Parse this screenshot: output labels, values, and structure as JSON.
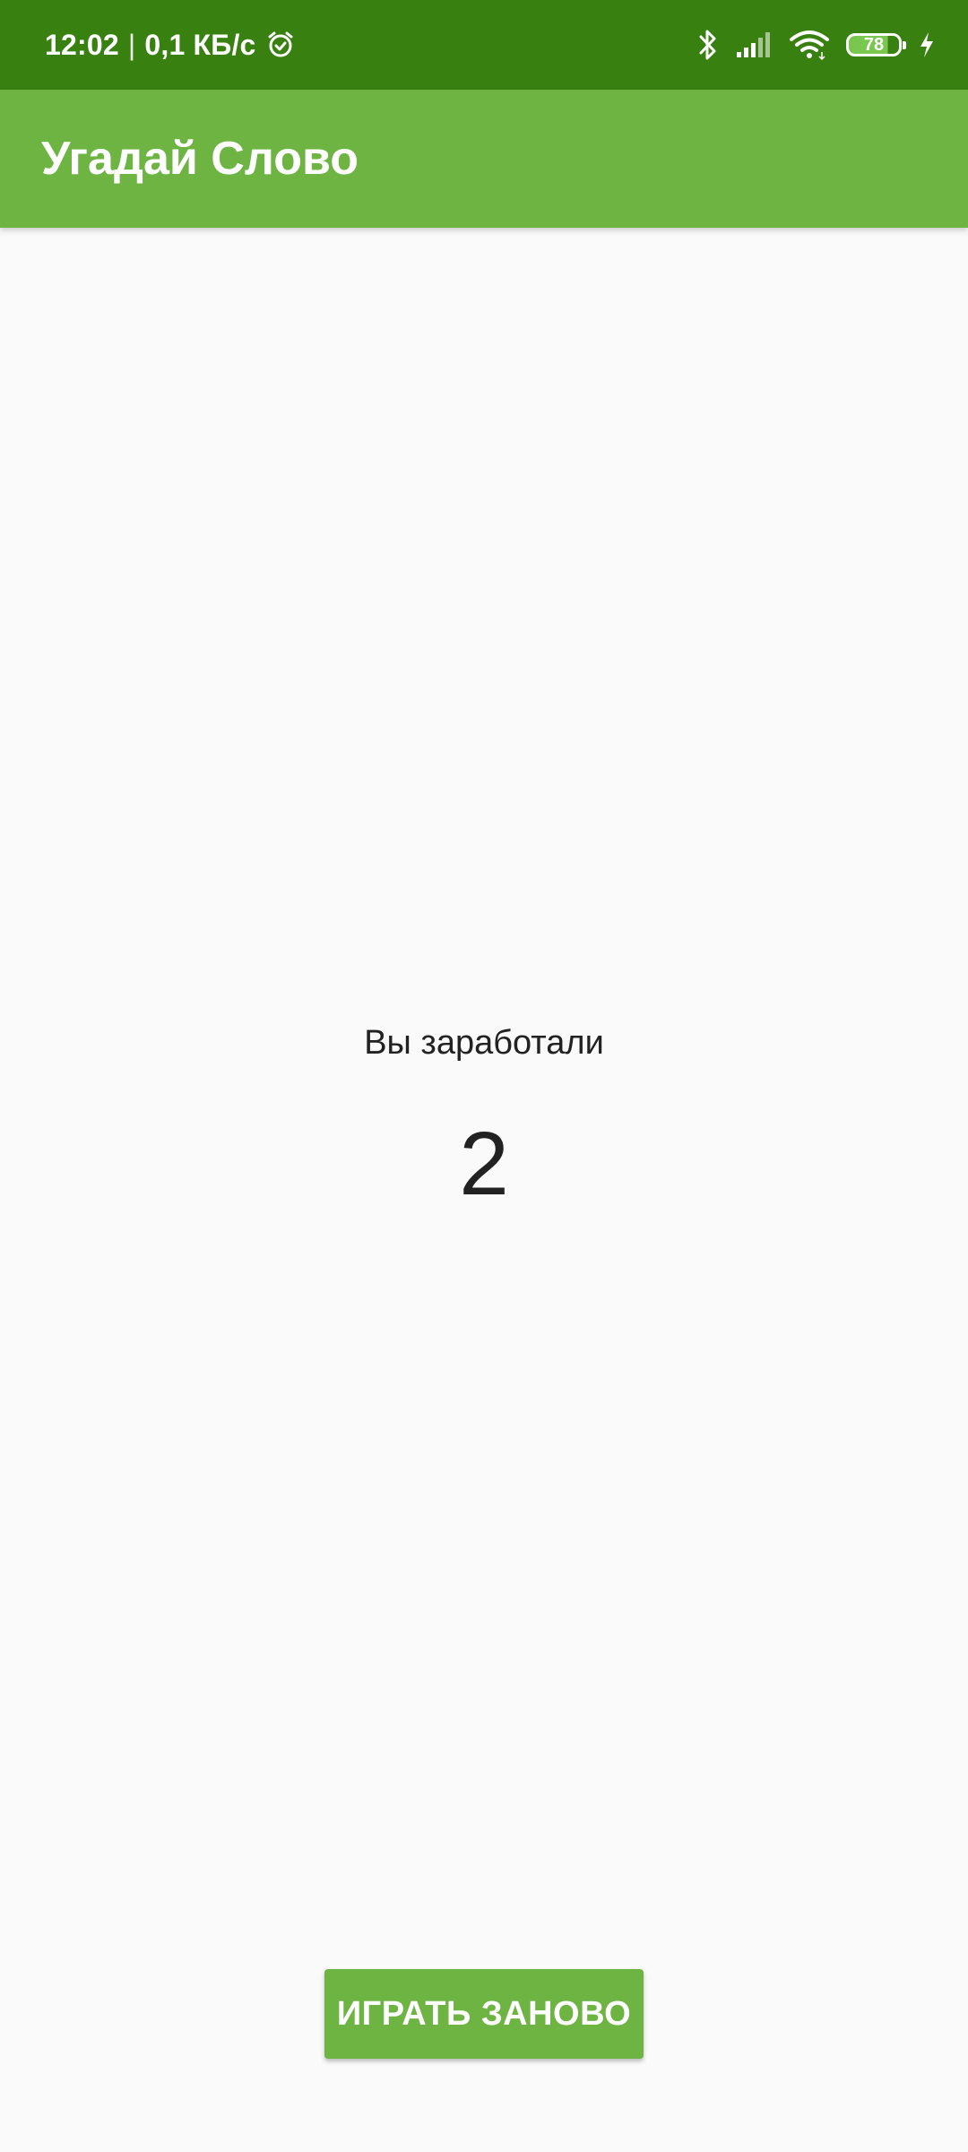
{
  "status_bar": {
    "time": "12:02",
    "separator": "|",
    "network_speed": "0,1 КБ/с",
    "battery_level": "78",
    "icons": [
      "alarm-icon",
      "bluetooth-icon",
      "signal-icon",
      "wifi-icon",
      "battery-icon",
      "charging-icon"
    ],
    "background_color": "#38800f"
  },
  "app_bar": {
    "title": "Угадай Слово",
    "background_color": "#6db443"
  },
  "main": {
    "score_label": "Вы заработали",
    "score_value": "2"
  },
  "actions": {
    "play_again_label": "ИГРАТЬ ЗАНОВО"
  }
}
